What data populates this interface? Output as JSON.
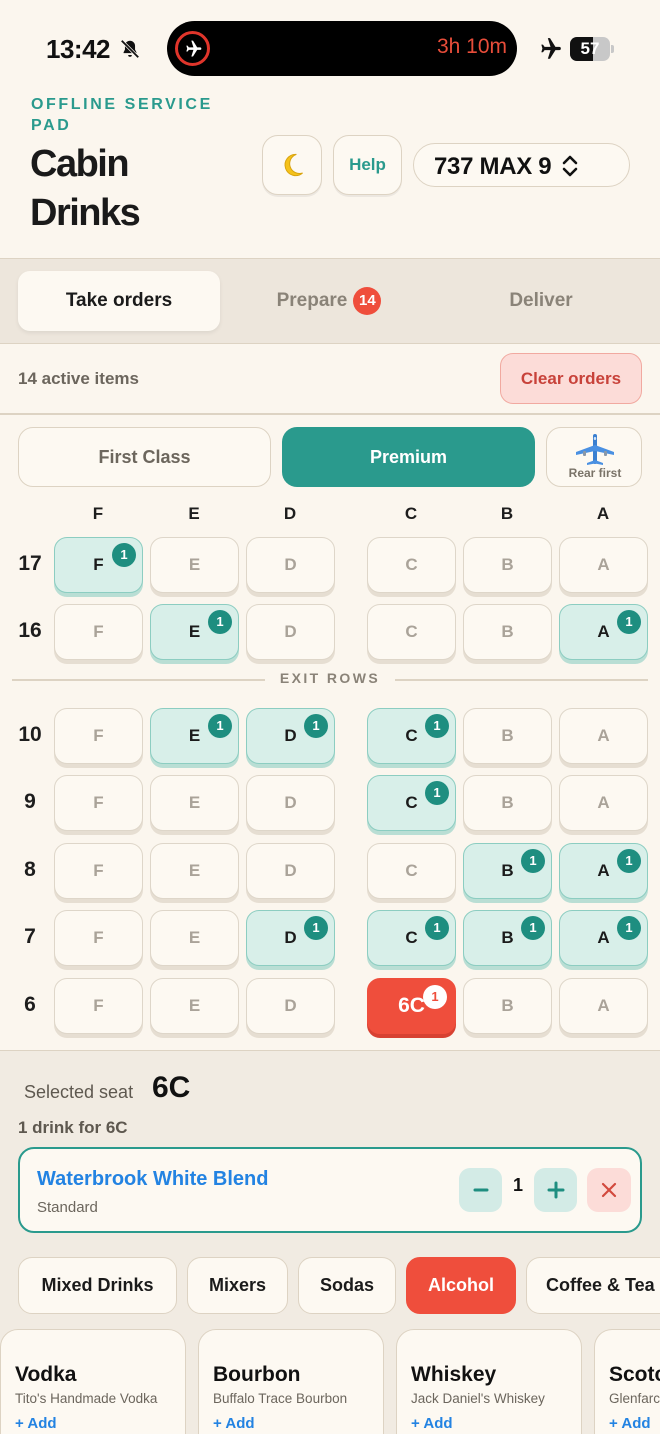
{
  "status_bar": {
    "time": "13:42",
    "activity_time": "3h 10m",
    "battery": "57",
    "battery_level": 0.57
  },
  "header": {
    "eyebrow": "OFFLINE SERVICE PAD",
    "title": "Cabin Drinks",
    "help_label": "Help",
    "aircraft": "737 MAX 9"
  },
  "tabs": [
    {
      "label": "Take orders",
      "active": true
    },
    {
      "label": "Prepare",
      "badge": "14",
      "active": false
    },
    {
      "label": "Deliver",
      "active": false
    }
  ],
  "summary": {
    "active_items": "14 active items",
    "clear_label": "Clear orders"
  },
  "cabin": {
    "first_label": "First Class",
    "premium_label": "Premium",
    "rear_label": "Rear first",
    "selected": "Premium"
  },
  "seat_map": {
    "columns": [
      "F",
      "E",
      "D",
      "C",
      "B",
      "A"
    ],
    "exit_label": "EXIT ROWS",
    "rows": [
      {
        "row": "17",
        "orders": {
          "F": 1
        }
      },
      {
        "row": "16",
        "orders": {
          "E": 1,
          "A": 1
        }
      },
      {
        "row": "10",
        "orders": {
          "E": 1,
          "D": 1,
          "C": 1
        }
      },
      {
        "row": "9",
        "orders": {
          "C": 1
        }
      },
      {
        "row": "8",
        "orders": {
          "B": 1,
          "A": 1
        }
      },
      {
        "row": "7",
        "orders": {
          "D": 1,
          "C": 1,
          "B": 1,
          "A": 1
        }
      },
      {
        "row": "6",
        "orders": {
          "C": 1
        }
      }
    ],
    "selected_seat": "6C"
  },
  "selection": {
    "label": "Selected seat",
    "seat": "6C",
    "drink_count": "1 drink for 6C",
    "order": {
      "name": "Waterbrook White Blend",
      "variant": "Standard",
      "quantity": "1"
    }
  },
  "categories": [
    {
      "label": "Mixed Drinks",
      "active": false
    },
    {
      "label": "Mixers",
      "active": false
    },
    {
      "label": "Sodas",
      "active": false
    },
    {
      "label": "Alcohol",
      "active": true
    },
    {
      "label": "Coffee & Tea",
      "active": false
    }
  ],
  "products": [
    {
      "name": "Vodka",
      "sub": "Tito's Handmade Vodka",
      "add": "+ Add"
    },
    {
      "name": "Bourbon",
      "sub": "Buffalo Trace Bourbon",
      "add": "+ Add"
    },
    {
      "name": "Whiskey",
      "sub": "Jack Daniel's Whiskey",
      "add": "+ Add"
    },
    {
      "name": "Scotch",
      "sub": "Glenfarclas",
      "add": "+ Add"
    }
  ],
  "colors": {
    "accent": "#2a9a8d",
    "danger": "#ef4e3c",
    "link": "#2383e2",
    "background": "#fbf6ee"
  },
  "icons": [
    "bell-slash-icon",
    "airplane-icon",
    "moon-icon",
    "chevron-up-down-icon",
    "airplane-rear-icon",
    "minus-icon",
    "plus-icon",
    "close-icon"
  ]
}
